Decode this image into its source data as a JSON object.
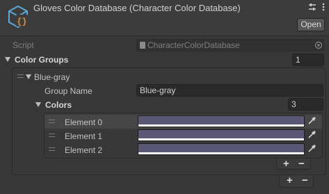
{
  "header": {
    "title": "Gloves Color Database (Character Color Database)",
    "open_label": "Open"
  },
  "script_field": {
    "label": "Script",
    "value": "CharacterColorDatabase"
  },
  "color_groups": {
    "label": "Color Groups",
    "size": "1",
    "items": [
      {
        "label": "Blue-gray",
        "group_name_label": "Group Name",
        "group_name_value": "Blue-gray",
        "colors_label": "Colors",
        "colors_size": "3",
        "elements": [
          {
            "label": "Element 0",
            "color": "#5a5876"
          },
          {
            "label": "Element 1",
            "color": "#5a5876"
          },
          {
            "label": "Element 2",
            "color": "#5a5876"
          }
        ]
      }
    ]
  },
  "list_controls": {
    "add": "+",
    "remove": "−"
  },
  "icons": {
    "asset": "scriptable-object-icon",
    "sliders": "sliders-icon",
    "menu": "menu-icon",
    "picker": "eyedropper-icon",
    "target": "object-picker-icon"
  },
  "colors": {
    "accent_text": "#d2d2d2",
    "panel_bg": "#383838"
  }
}
